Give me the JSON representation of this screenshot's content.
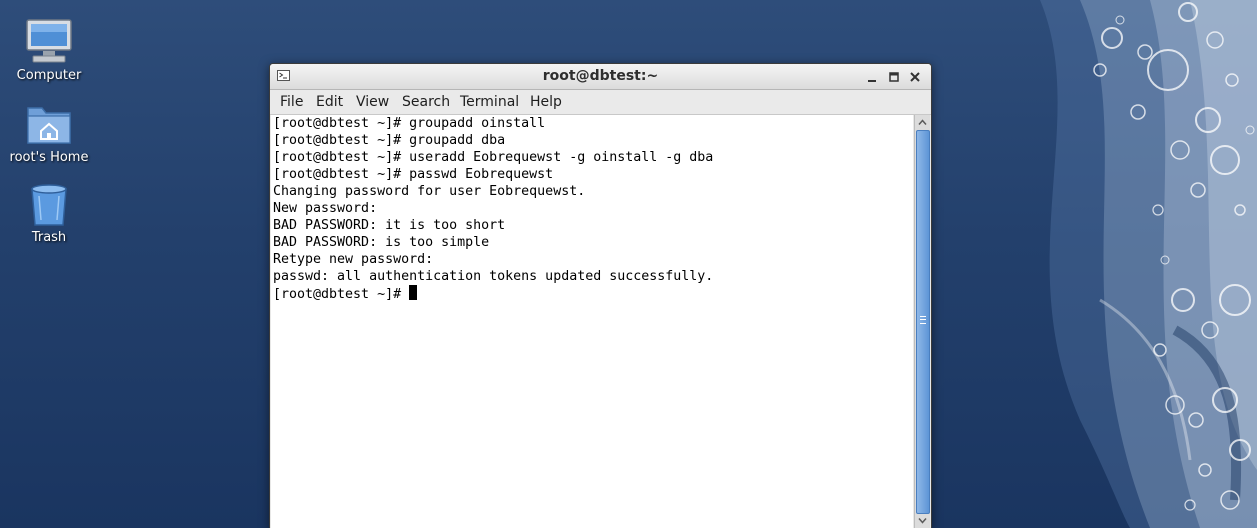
{
  "desktop": {
    "icons": [
      {
        "label": "Computer",
        "icon": "computer-icon"
      },
      {
        "label": "root's Home",
        "icon": "home-folder-icon"
      },
      {
        "label": "Trash",
        "icon": "trash-icon"
      }
    ]
  },
  "window": {
    "title": "root@dbtest:~",
    "icon": "terminal-icon",
    "buttons": [
      "minimize-icon",
      "maximize-icon",
      "close-icon"
    ]
  },
  "menubar": {
    "items": [
      "File",
      "Edit",
      "View",
      "Search",
      "Terminal",
      "Help"
    ]
  },
  "terminal": {
    "lines": [
      "[root@dbtest ~]# groupadd oinstall",
      "[root@dbtest ~]# groupadd dba",
      "[root@dbtest ~]# useradd Eobrequewst -g oinstall -g dba",
      "[root@dbtest ~]# passwd Eobrequewst",
      "Changing password for user Eobrequewst.",
      "New password:",
      "BAD PASSWORD: it is too short",
      "BAD PASSWORD: is too simple",
      "Retype new password:",
      "passwd: all authentication tokens updated successfully.",
      "[root@dbtest ~]# "
    ]
  },
  "colors": {
    "desktop_background": "#23406c",
    "scroll_thumb": "#5d95d6",
    "terminal_background": "#ffffff",
    "terminal_text": "#000000"
  }
}
